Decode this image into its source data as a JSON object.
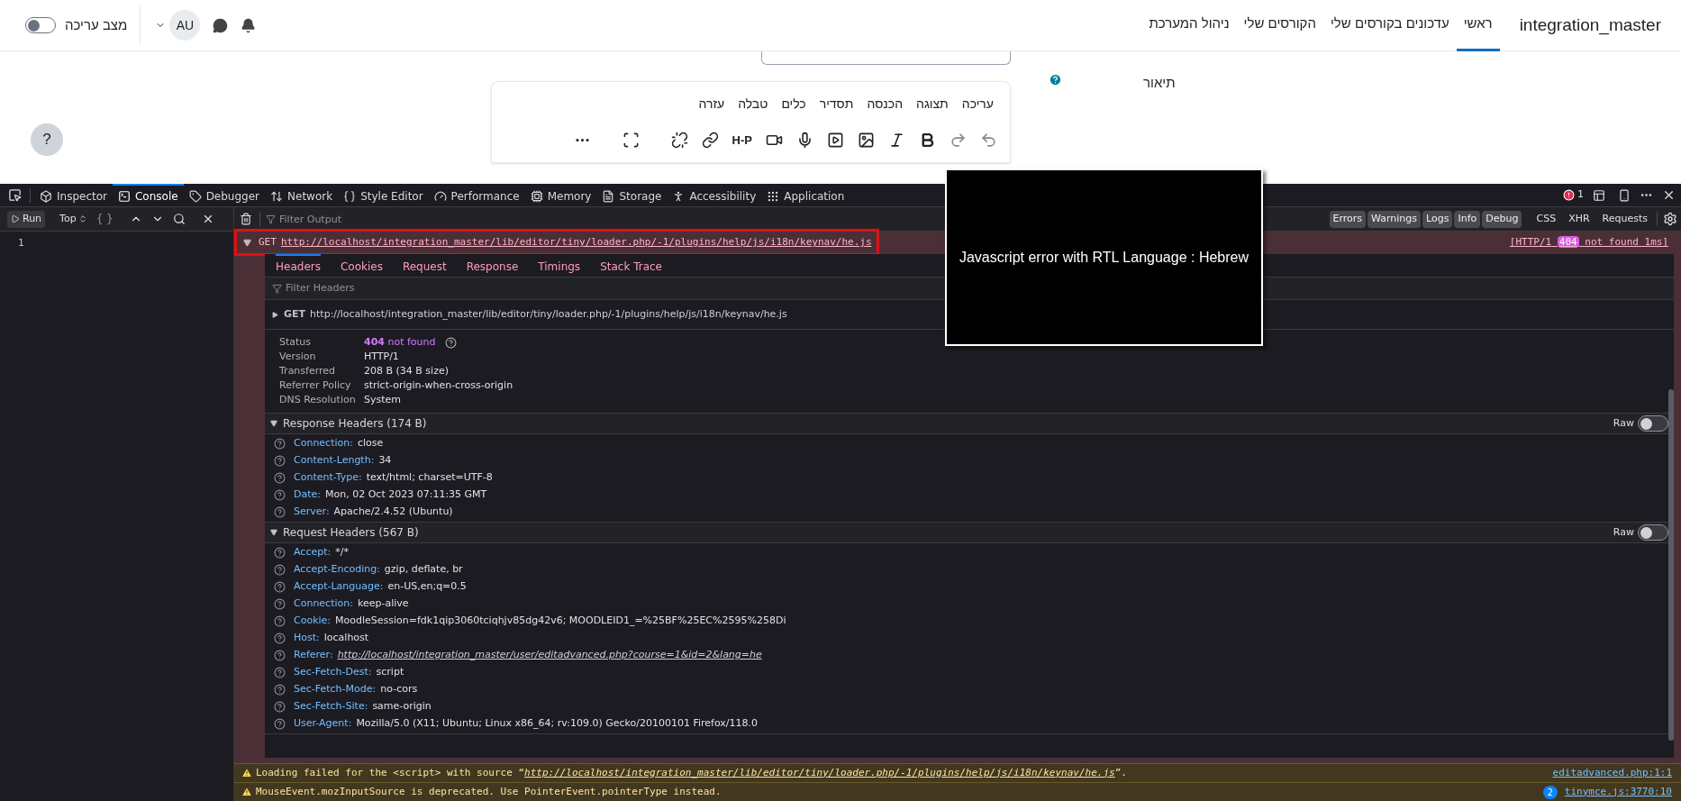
{
  "header": {
    "brand": "integration_master",
    "nav": [
      {
        "label": "ראשי",
        "selected": true
      },
      {
        "label": "עדכונים בקורסים שלי",
        "selected": false
      },
      {
        "label": "הקורסים שלי",
        "selected": false
      },
      {
        "label": "ניהול המערכת",
        "selected": false
      }
    ],
    "avatar": "AU",
    "edit_mode": {
      "label": "מצב עריכה",
      "on": false
    }
  },
  "form": {
    "field_label": "תיאור",
    "help_button": "?",
    "editor": {
      "menu": [
        "עריכה",
        "תצוגה",
        "הכנסה",
        "תסדיר",
        "כלים",
        "טבלה",
        "עזרה"
      ],
      "h5p_label": "H-P"
    }
  },
  "devtools": {
    "tabs": [
      {
        "label": "Inspector",
        "selected": false
      },
      {
        "label": "Console",
        "selected": true
      },
      {
        "label": "Debugger",
        "selected": false
      },
      {
        "label": "Network",
        "selected": false
      },
      {
        "label": "Style Editor",
        "selected": false
      },
      {
        "label": "Performance",
        "selected": false
      },
      {
        "label": "Memory",
        "selected": false
      },
      {
        "label": "Storage",
        "selected": false
      },
      {
        "label": "Accessibility",
        "selected": false
      },
      {
        "label": "Application",
        "selected": false
      }
    ],
    "error_count": "1",
    "editor_pane": {
      "run": "Run",
      "context": "Top",
      "pretty": "{ }",
      "line_numbers": [
        "1"
      ]
    },
    "filter_placeholder": "Filter Output",
    "filters": [
      {
        "label": "Errors",
        "selected": true
      },
      {
        "label": "Warnings",
        "selected": true
      },
      {
        "label": "Logs",
        "selected": true
      },
      {
        "label": "Info",
        "selected": true
      },
      {
        "label": "Debug",
        "selected": true
      },
      {
        "label": "CSS",
        "selected": false
      },
      {
        "label": "XHR",
        "selected": false
      },
      {
        "label": "Requests",
        "selected": false
      }
    ],
    "request": {
      "method": "GET",
      "url": "http://localhost/integration_master/lib/editor/tiny/loader.php/-1/plugins/help/js/i18n/keynav/he.js",
      "status_prefix": "[HTTP/1",
      "status_code": "404",
      "status_suffix": "not found 1ms]",
      "tabs": [
        {
          "label": "Headers",
          "selected": true
        },
        {
          "label": "Cookies",
          "selected": false
        },
        {
          "label": "Request",
          "selected": false
        },
        {
          "label": "Response",
          "selected": false
        },
        {
          "label": "Timings",
          "selected": false
        },
        {
          "label": "Stack Trace",
          "selected": false
        }
      ],
      "filter_headers_placeholder": "Filter Headers",
      "summary": {
        "method": "GET",
        "url": "http://localhost/integration_master/lib/editor/tiny/loader.php/-1/plugins/help/js/i18n/keynav/he.js"
      },
      "status": {
        "label": "Status",
        "code": "404",
        "text": "not found"
      },
      "info": [
        {
          "label": "Version",
          "value": "HTTP/1"
        },
        {
          "label": "Transferred",
          "value": "208 B (34 B size)"
        },
        {
          "label": "Referrer Policy",
          "value": "strict-origin-when-cross-origin"
        },
        {
          "label": "DNS Resolution",
          "value": "System"
        }
      ],
      "sections": [
        {
          "title": "Response Headers (174 B)",
          "raw_label": "Raw",
          "raw_on": false,
          "expanded": true,
          "headers": [
            {
              "name": "Connection:",
              "value": "close",
              "kind": "text"
            },
            {
              "name": "Content-Length:",
              "value": "34",
              "kind": "text"
            },
            {
              "name": "Content-Type:",
              "value": "text/html; charset=UTF-8",
              "kind": "text"
            },
            {
              "name": "Date:",
              "value": "Mon, 02 Oct 2023 07:11:35 GMT",
              "kind": "text"
            },
            {
              "name": "Server:",
              "value": "Apache/2.4.52 (Ubuntu)",
              "kind": "text"
            }
          ]
        },
        {
          "title": "Request Headers (567 B)",
          "raw_label": "Raw",
          "raw_on": false,
          "expanded": true,
          "headers": [
            {
              "name": "Accept:",
              "value": "*/*",
              "kind": "text"
            },
            {
              "name": "Accept-Encoding:",
              "value": "gzip, deflate, br",
              "kind": "text"
            },
            {
              "name": "Accept-Language:",
              "value": "en-US,en;q=0.5",
              "kind": "text"
            },
            {
              "name": "Connection:",
              "value": "keep-alive",
              "kind": "text"
            },
            {
              "name": "Cookie:",
              "value": "MoodleSession=fdk1qip3060tciqhjv85dg42v6; MOODLEID1_=%25BF%25EC%2595%258Di",
              "kind": "text"
            },
            {
              "name": "Host:",
              "value": "localhost",
              "kind": "text"
            },
            {
              "name": "Referer:",
              "value": "http://localhost/integration_master/user/editadvanced.php?course=1&id=2&lang=he",
              "kind": "link"
            },
            {
              "name": "Sec-Fetch-Dest:",
              "value": "script",
              "kind": "text"
            },
            {
              "name": "Sec-Fetch-Mode:",
              "value": "no-cors",
              "kind": "text"
            },
            {
              "name": "Sec-Fetch-Site:",
              "value": "same-origin",
              "kind": "text"
            },
            {
              "name": "User-Agent:",
              "value": "Mozilla/5.0 (X11; Ubuntu; Linux x86_64; rv:109.0) Gecko/20100101 Firefox/118.0",
              "kind": "text"
            }
          ]
        }
      ]
    },
    "messages": [
      {
        "before": "Loading failed for the <script> with source “",
        "link": "http://localhost/integration_master/lib/editor/tiny/loader.php/-1/plugins/help/js/i18n/keynav/he.js",
        "after": "”.",
        "location": "editadvanced.php:1:1"
      },
      {
        "before": "MouseEvent.mozInputSource is deprecated. Use PointerEvent.pointerType instead.",
        "repeat": "2",
        "location": "tinymce.js:3770:10"
      }
    ]
  },
  "annotation": "Javascript error with RTL Language : Hebrew"
}
